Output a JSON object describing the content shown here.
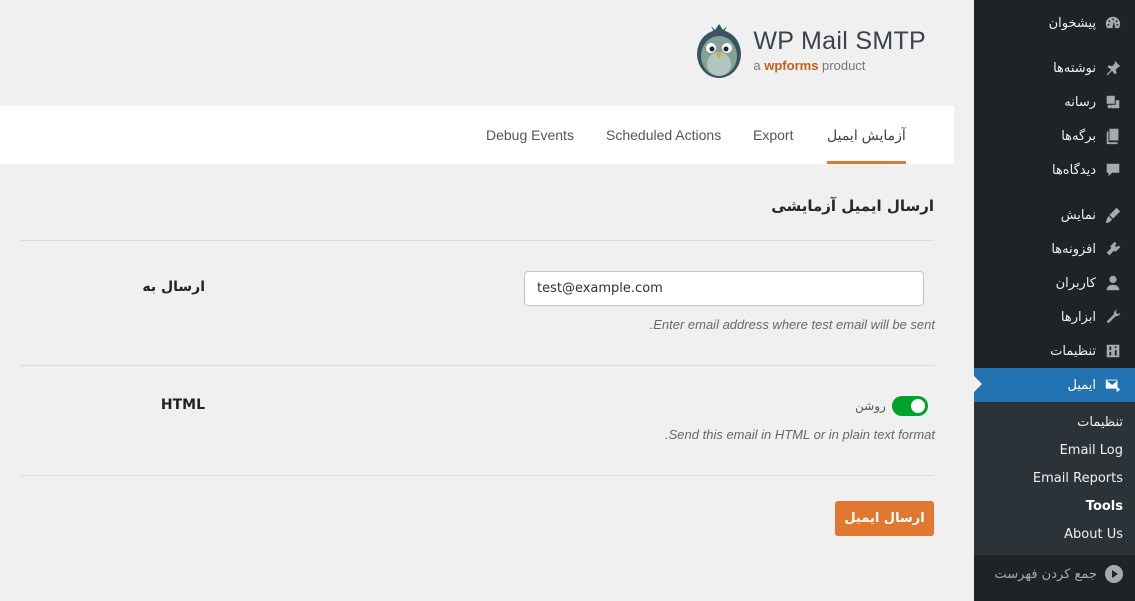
{
  "sidebar": {
    "menu_group1": [
      {
        "label": "پیشخوان",
        "icon": "dashboard-icon"
      }
    ],
    "menu_group2": [
      {
        "label": "نوشته‌ها",
        "icon": "pin-icon"
      },
      {
        "label": "رسانه",
        "icon": "media-icon"
      },
      {
        "label": "برگه‌ها",
        "icon": "pages-icon"
      },
      {
        "label": "دیدگاه‌ها",
        "icon": "comments-icon"
      }
    ],
    "menu_group3": [
      {
        "label": "نمایش",
        "icon": "appearance-icon"
      },
      {
        "label": "افزونه‌ها",
        "icon": "plugins-icon"
      },
      {
        "label": "کاربران",
        "icon": "users-icon"
      },
      {
        "label": "ابزارها",
        "icon": "tools-icon"
      },
      {
        "label": "تنظیمات",
        "icon": "settings-icon"
      }
    ],
    "active_item": {
      "label": "ایمیل",
      "icon": "email-icon"
    },
    "submenu": [
      "تنظیمات",
      "Email Log",
      "Email Reports",
      "Tools",
      "About Us"
    ],
    "collapse_label": "جمع کردن فهرست"
  },
  "brand": {
    "title": "WP Mail SMTP",
    "sub_prefix": "a",
    "sub_brand": "wpforms",
    "sub_suffix": "product"
  },
  "tabs": [
    "آزمایش ایمیل",
    "Export",
    "Scheduled Actions",
    "Debug Events"
  ],
  "content": {
    "section_title": "ارسال ایمیل آزمایشی",
    "send_to_label": "ارسال به",
    "email_value": "test@example.com",
    "email_desc": "Enter email address where test email will be sent.",
    "html_label": "HTML",
    "toggle_text": "روشن",
    "toggle_on": true,
    "html_desc": "Send this email in HTML or in plain text format.",
    "send_button": "ارسال ایمیل"
  },
  "colors": {
    "sidebar_bg": "#1d2327",
    "active_blue": "#2271b1",
    "accent_orange": "#e27730",
    "toggle_green": "#00a32a"
  }
}
